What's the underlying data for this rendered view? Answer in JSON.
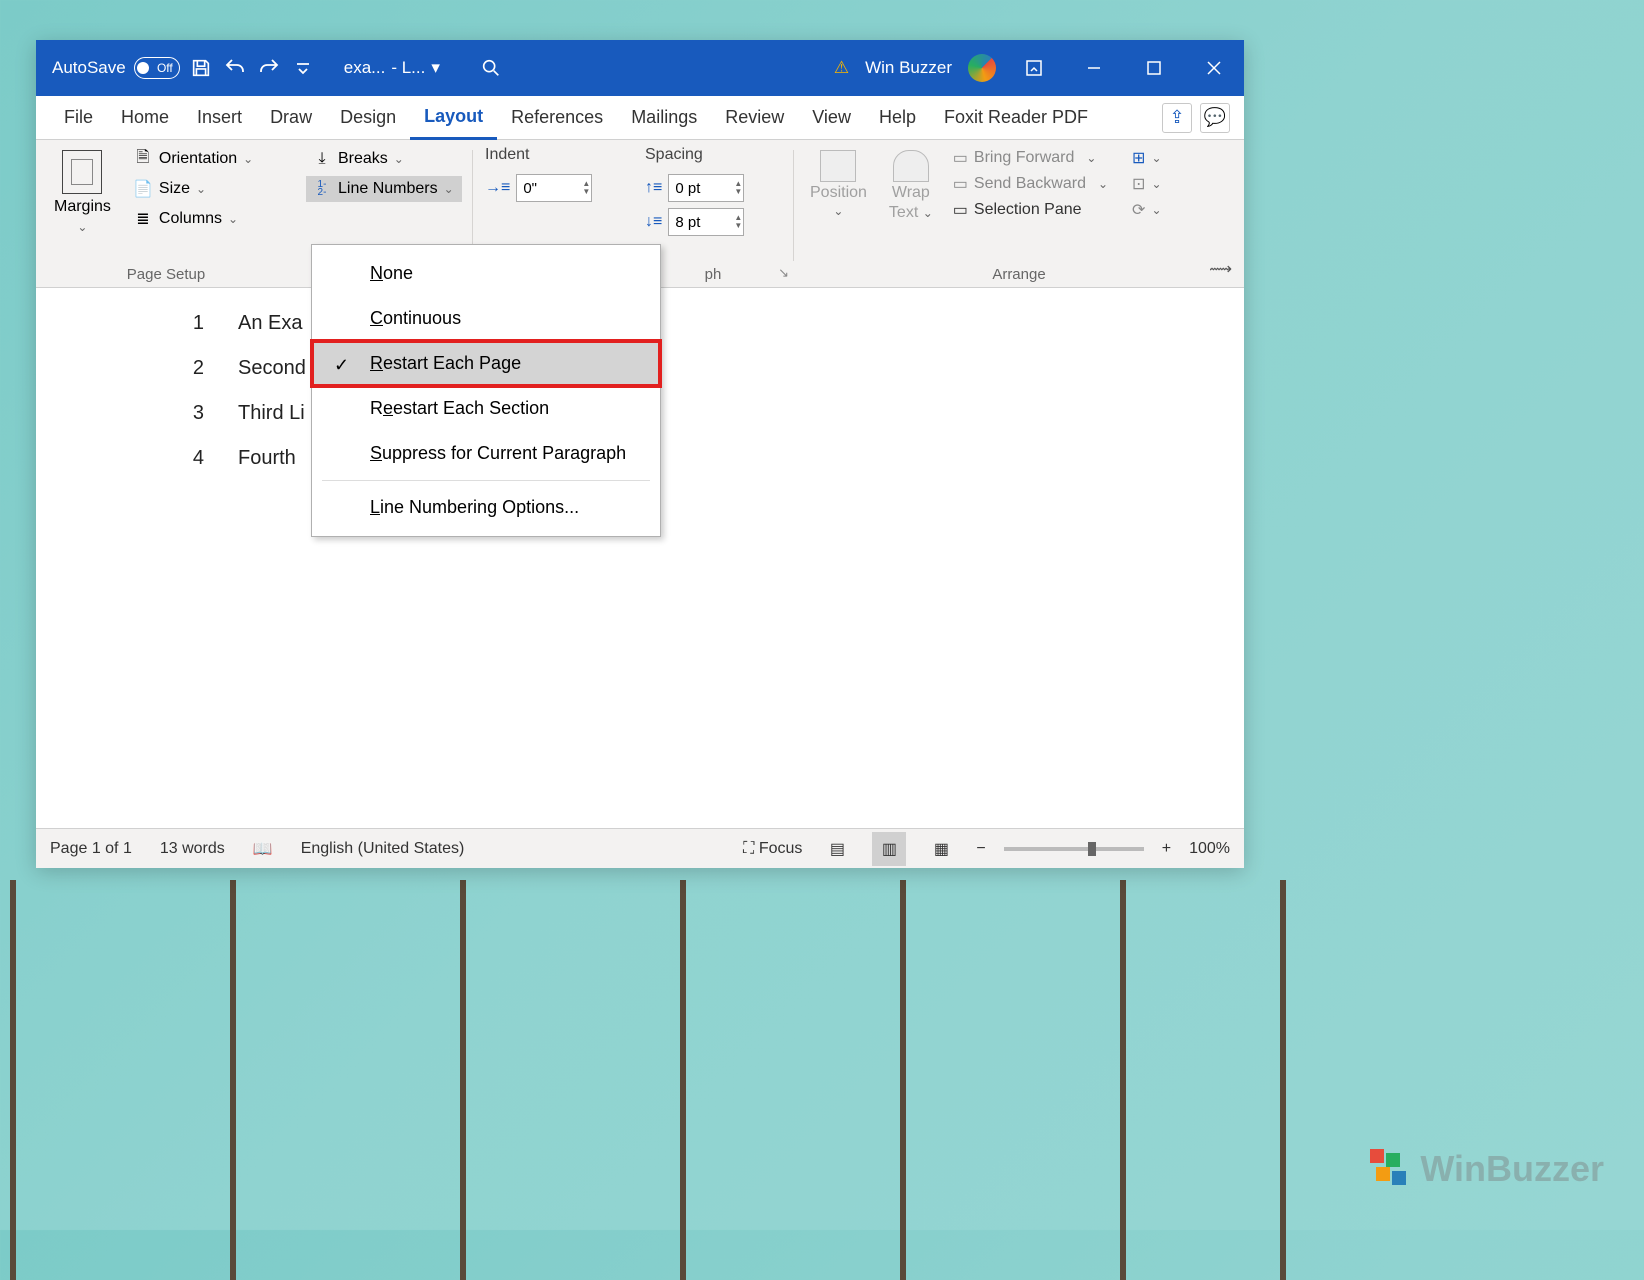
{
  "titlebar": {
    "autosave_label": "AutoSave",
    "autosave_state": "Off",
    "doc_name": "exa...",
    "doc_suffix": "- L...",
    "user_name": "Win Buzzer"
  },
  "tabs": {
    "file": "File",
    "home": "Home",
    "insert": "Insert",
    "draw": "Draw",
    "design": "Design",
    "layout": "Layout",
    "references": "References",
    "mailings": "Mailings",
    "review": "Review",
    "view": "View",
    "help": "Help",
    "foxit": "Foxit Reader PDF"
  },
  "ribbon": {
    "margins": "Margins",
    "orientation": "Orientation",
    "size": "Size",
    "columns": "Columns",
    "breaks": "Breaks",
    "line_numbers": "Line Numbers",
    "page_setup_label": "Page Setup",
    "indent_label": "Indent",
    "indent_left": "0\"",
    "spacing_label": "Spacing",
    "spacing_before": "0 pt",
    "spacing_after": "8 pt",
    "paragraph_label_visible": "ph",
    "position": "Position",
    "wrap_text1": "Wrap",
    "wrap_text2": "Text",
    "bring_forward": "Bring Forward",
    "send_backward": "Send Backward",
    "selection_pane": "Selection Pane",
    "arrange_label": "Arrange"
  },
  "dropdown": {
    "none": "one",
    "continuous": "ontinuous",
    "restart_page": "estart Each Page",
    "restart_section": "estart Each Section",
    "suppress": "uppress for Current Paragraph",
    "options": "ine Numbering Options..."
  },
  "document": {
    "lines": [
      {
        "n": "1",
        "text": "An Exa"
      },
      {
        "n": "2",
        "text": "Second"
      },
      {
        "n": "3",
        "text": "Third Li"
      },
      {
        "n": "4",
        "text": "Fourth "
      }
    ]
  },
  "statusbar": {
    "page": "Page 1 of 1",
    "words": "13 words",
    "language": "English (United States)",
    "focus": "Focus",
    "zoom": "100%"
  },
  "watermark": "WinBuzzer"
}
